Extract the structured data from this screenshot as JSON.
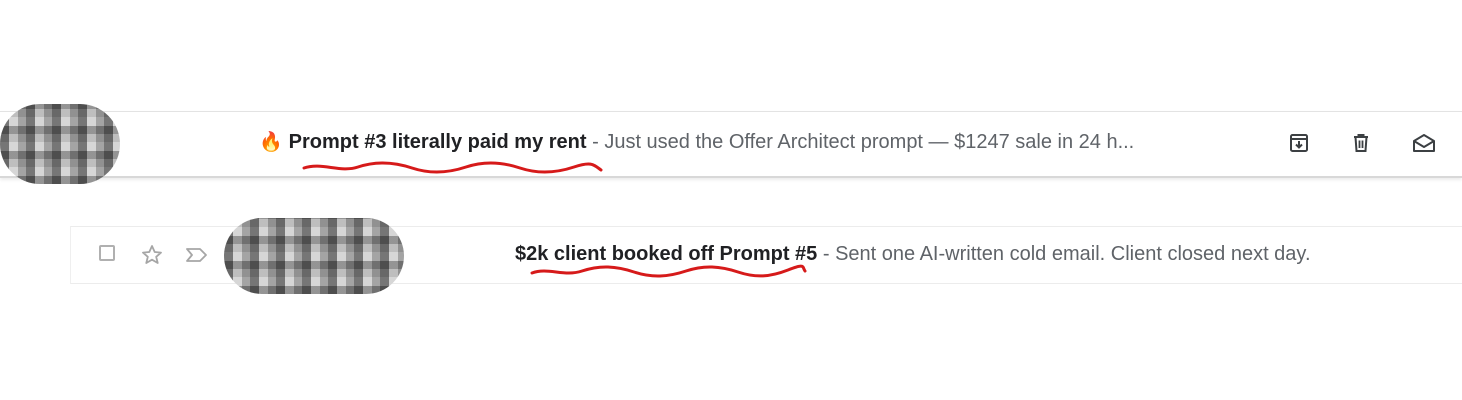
{
  "emails": [
    {
      "emoji": "🔥",
      "subject": "Prompt #3 literally paid my rent",
      "snippet": " - Just used the Offer Architect prompt — $1247 sale in 24 h...",
      "actions": [
        "archive-icon",
        "trash-icon",
        "mark-unread-icon"
      ],
      "annotation_color": "#d61a1a"
    },
    {
      "subject": "$2k client booked off Prompt #5",
      "snippet": " - Sent one AI-written cold email. Client closed next day.",
      "controls": [
        "checkbox",
        "star-icon",
        "important-marker-icon"
      ],
      "annotation_color": "#d61a1a"
    }
  ]
}
